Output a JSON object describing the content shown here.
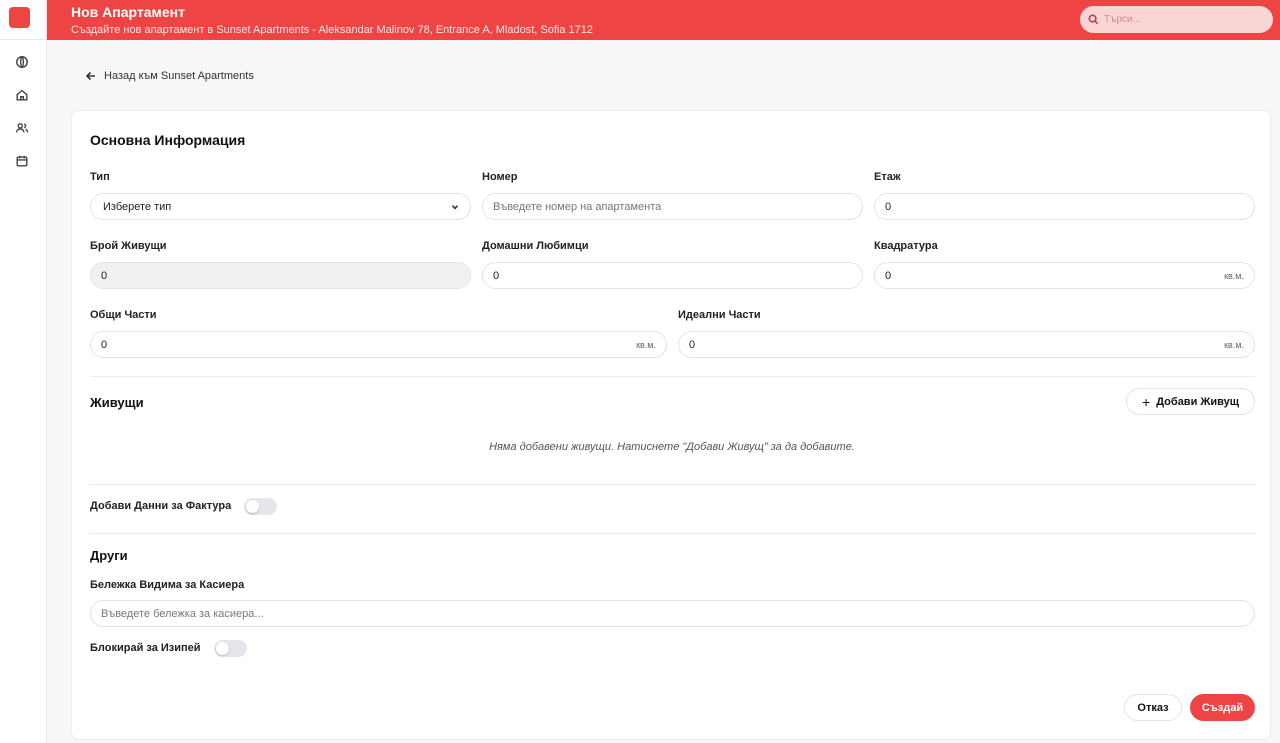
{
  "header": {
    "title": "Нов Апартамент",
    "subtitle": "Създайте нов апартамент в Sunset Apartments - Aleksandar Malinov 78, Entrance A, Mladost, Sofia 1712",
    "search_placeholder": "Търси..."
  },
  "sidebar": {
    "icons": [
      "globe-icon",
      "home-icon",
      "users-icon",
      "calendar-icon"
    ]
  },
  "back_link": "Назад към Sunset Apartments",
  "form": {
    "section_title": "Основна Информация",
    "type": {
      "label": "Тип",
      "value": "Изберете тип"
    },
    "number": {
      "label": "Номер",
      "placeholder": "Въведете номер на апартамента"
    },
    "floor": {
      "label": "Етаж",
      "value": "0"
    },
    "residents_count": {
      "label": "Брой Живущи",
      "value": "0"
    },
    "pets": {
      "label": "Домашни Любимци",
      "value": "0"
    },
    "area": {
      "label": "Квадратура",
      "value": "0",
      "unit": "кв.м."
    },
    "common_parts": {
      "label": "Общи Части",
      "value": "0",
      "unit": "кв.м."
    },
    "ideal_parts": {
      "label": "Идеални Части",
      "value": "0",
      "unit": "кв.м."
    }
  },
  "residents": {
    "title": "Живущи",
    "add_button": "Добави Живущ",
    "empty_text": "Няма добавени живущи. Натиснете \"Добави Живущ\" за да добавите."
  },
  "invoice": {
    "label": "Добави Данни за Фактура",
    "enabled": false
  },
  "other": {
    "title": "Други",
    "note_label": "Бележка Видима за Касиера",
    "note_placeholder": "Въведете бележка за касиера...",
    "block_label": "Блокирай за Изипей",
    "block_enabled": false
  },
  "actions": {
    "cancel": "Отказ",
    "create": "Създай"
  },
  "colors": {
    "accent": "#ef4444"
  }
}
